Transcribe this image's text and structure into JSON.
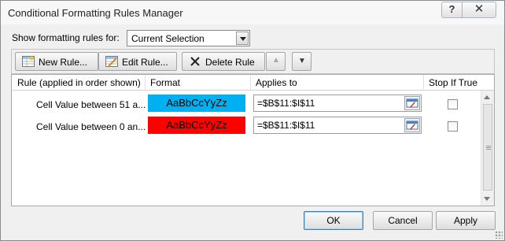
{
  "window": {
    "title": "Conditional Formatting Rules Manager"
  },
  "titlebar": {
    "help_label": "?",
    "close_label": "✕"
  },
  "filter": {
    "label": "Show formatting rules for:",
    "selected": "Current Selection"
  },
  "toolbar": {
    "new_rule": "New Rule...",
    "edit_rule": "Edit Rule...",
    "delete_rule": "Delete Rule",
    "move_up": "▲",
    "move_down": "▼"
  },
  "table": {
    "headers": [
      "Rule (applied in order shown)",
      "Format",
      "Applies to",
      "Stop If True"
    ],
    "rows": [
      {
        "rule": "Cell Value between 51 a...",
        "format_preview": "AaBbCcYyZz",
        "format_color": "#00b0f0",
        "applies_to": "=$B$11:$I$11",
        "stop_if_true": false
      },
      {
        "rule": "Cell Value between 0 an...",
        "format_preview": "AaBbCcYyZz",
        "format_color": "#ff0000",
        "applies_to": "=$B$11:$I$11",
        "stop_if_true": false
      }
    ]
  },
  "footer": {
    "ok": "OK",
    "cancel": "Cancel",
    "apply": "Apply"
  }
}
